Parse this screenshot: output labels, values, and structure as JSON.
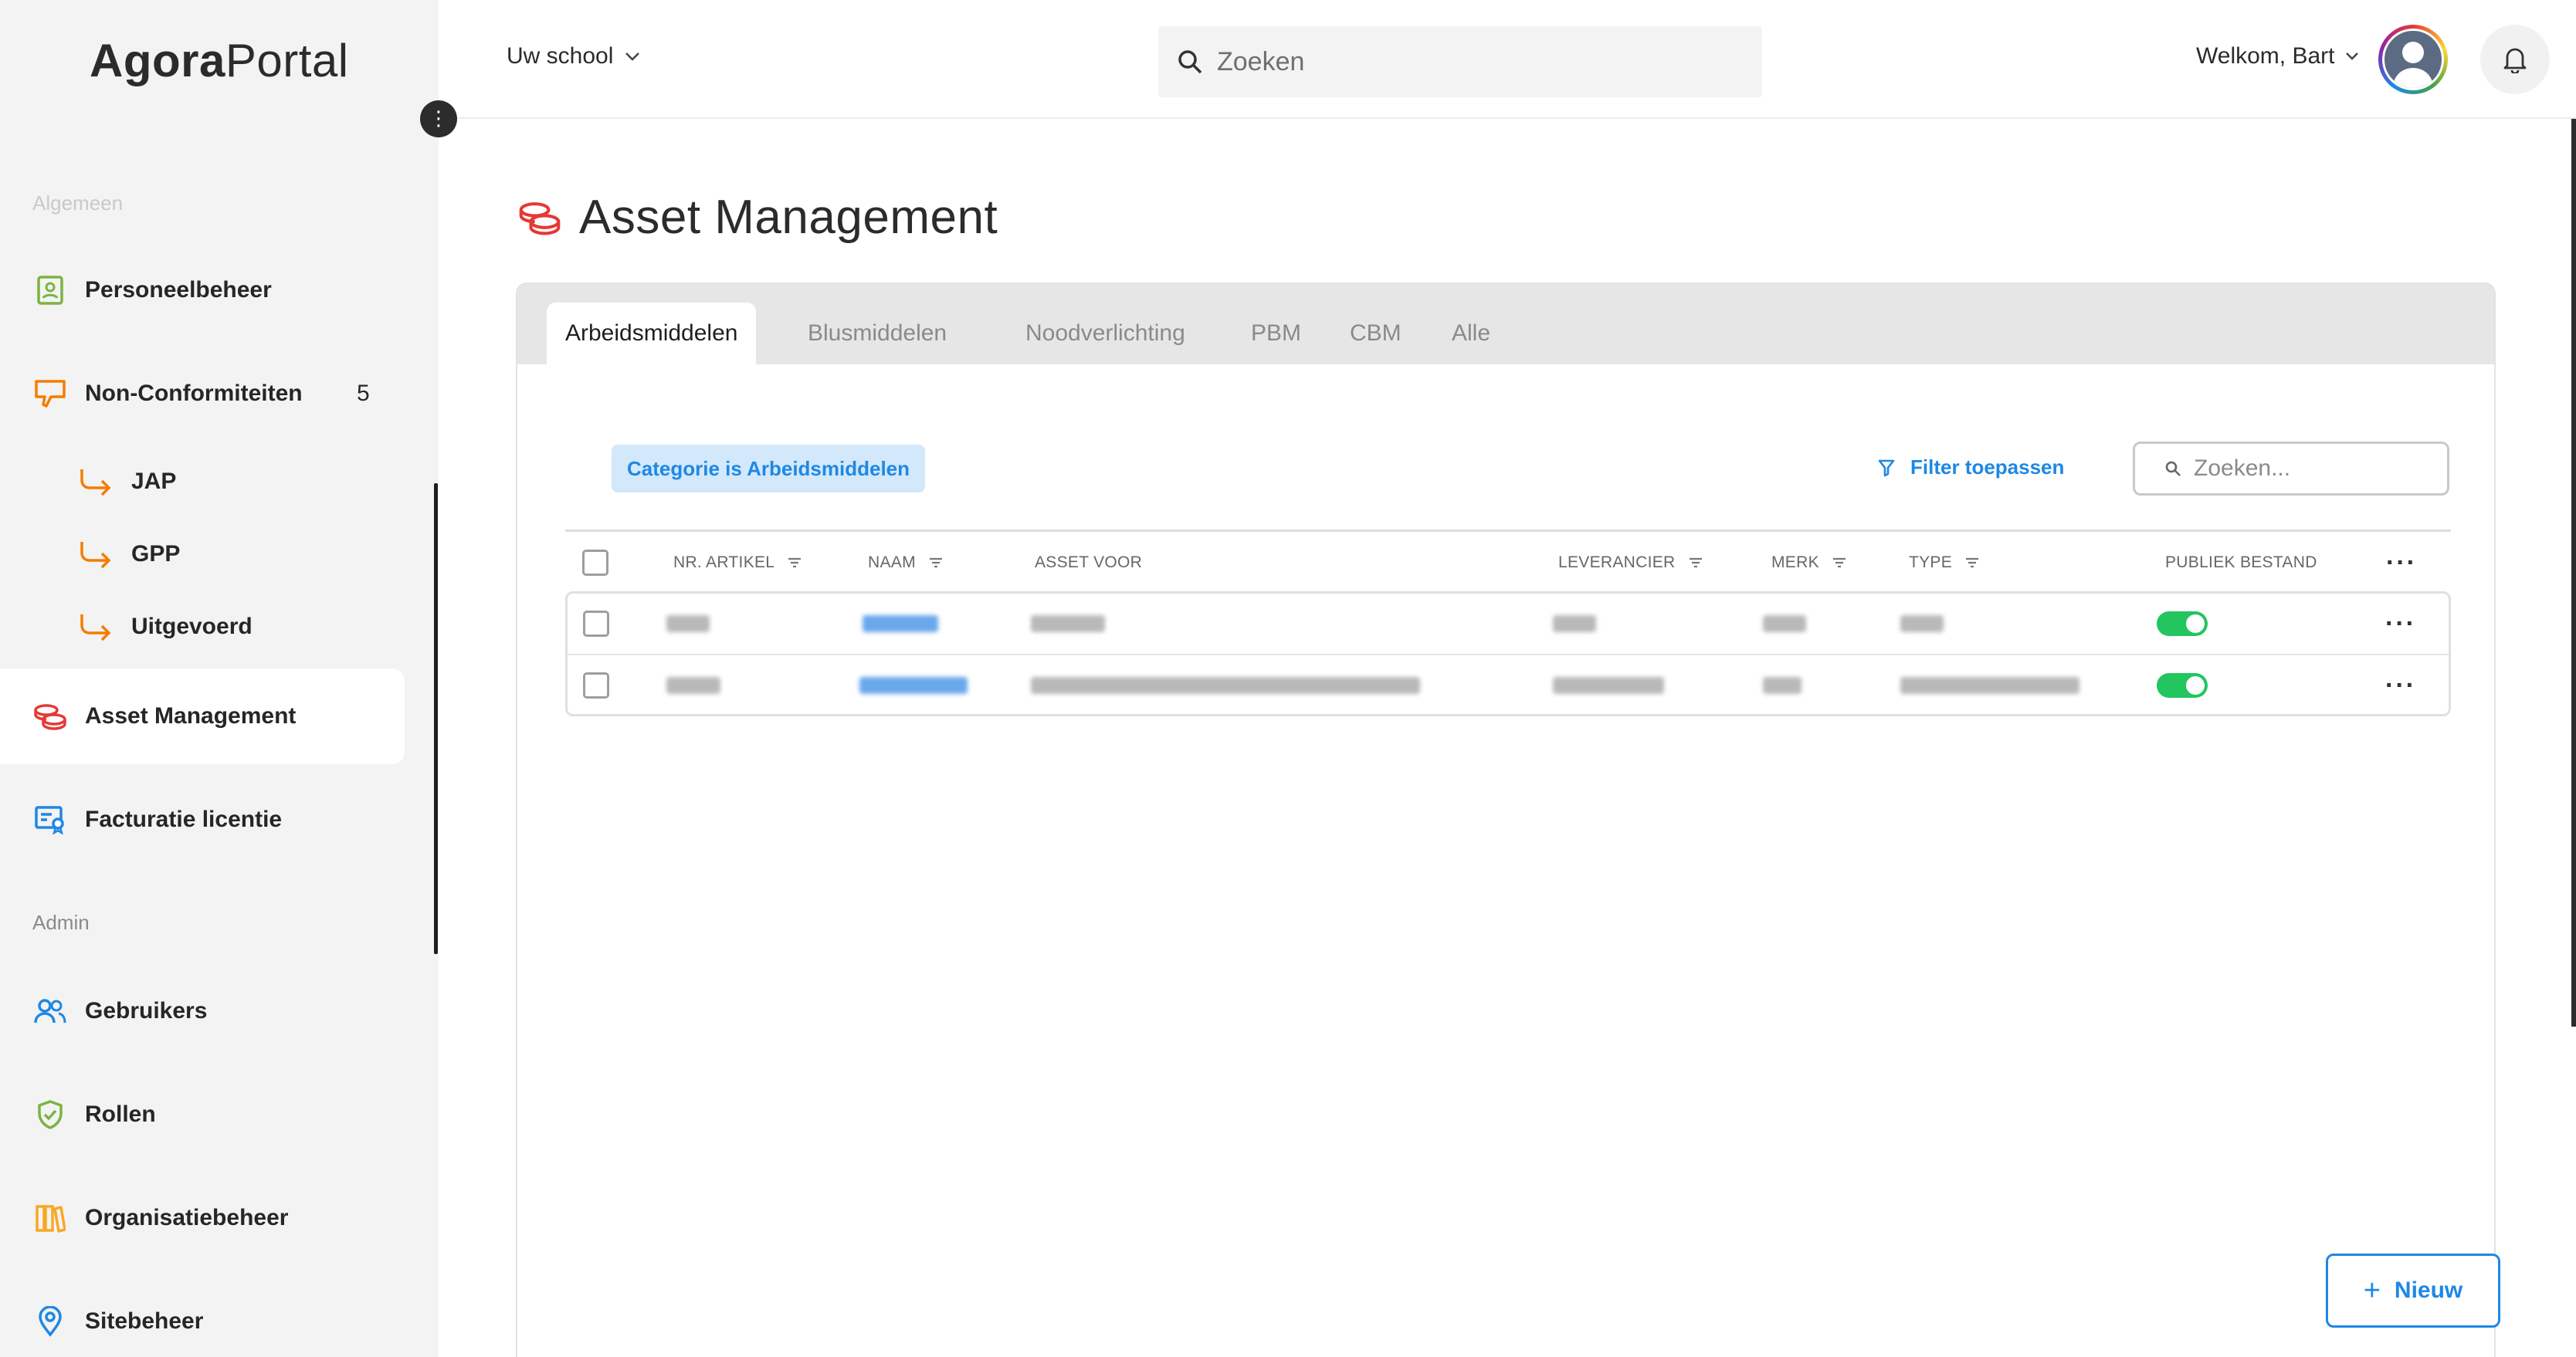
{
  "brand": {
    "part1": "Agora",
    "part2": "Portal"
  },
  "topbar": {
    "school_label": "Uw school",
    "search_placeholder": "Zoeken",
    "welcome": "Welkom, Bart"
  },
  "sidebar": {
    "section_general": "Algemeen",
    "section_admin": "Admin",
    "items": {
      "personeel": "Personeelbeheer",
      "nonconf": "Non-Conformiteiten",
      "nonconf_count": "5",
      "jap": "JAP",
      "gpp": "GPP",
      "uitgevoerd": "Uitgevoerd",
      "asset": "Asset Management",
      "facturatie": "Facturatie licentie",
      "gebruikers": "Gebruikers",
      "rollen": "Rollen",
      "organisatie": "Organisatiebeheer",
      "site": "Sitebeheer"
    }
  },
  "page": {
    "title": "Asset Management"
  },
  "tabs": [
    "Arbeidsmiddelen",
    "Blusmiddelen",
    "Noodverlichting",
    "PBM",
    "CBM",
    "Alle"
  ],
  "active_tab": "Arbeidsmiddelen",
  "filter": {
    "chip": "Categorie is Arbeidsmiddelen",
    "apply_label": "Filter toepassen",
    "search_placeholder": "Zoeken..."
  },
  "table": {
    "headers": {
      "nr_artikel": "NR. ARTIKEL",
      "naam": "NAAM",
      "asset_voor": "ASSET VOOR",
      "leverancier": "LEVERANCIER",
      "merk": "MERK",
      "type": "TYPE",
      "publiek": "PUBLIEK BESTAND"
    },
    "rows": [
      {
        "publiek_bestand": true
      },
      {
        "publiek_bestand": true
      }
    ]
  },
  "actions": {
    "new_label": "Nieuw"
  },
  "colors": {
    "accent": "#1e88e5",
    "toggle_on": "#22c55e",
    "sidebar_bg": "#f3f3f3",
    "orange_icon": "#f57c00",
    "red_icon": "#e53935"
  }
}
